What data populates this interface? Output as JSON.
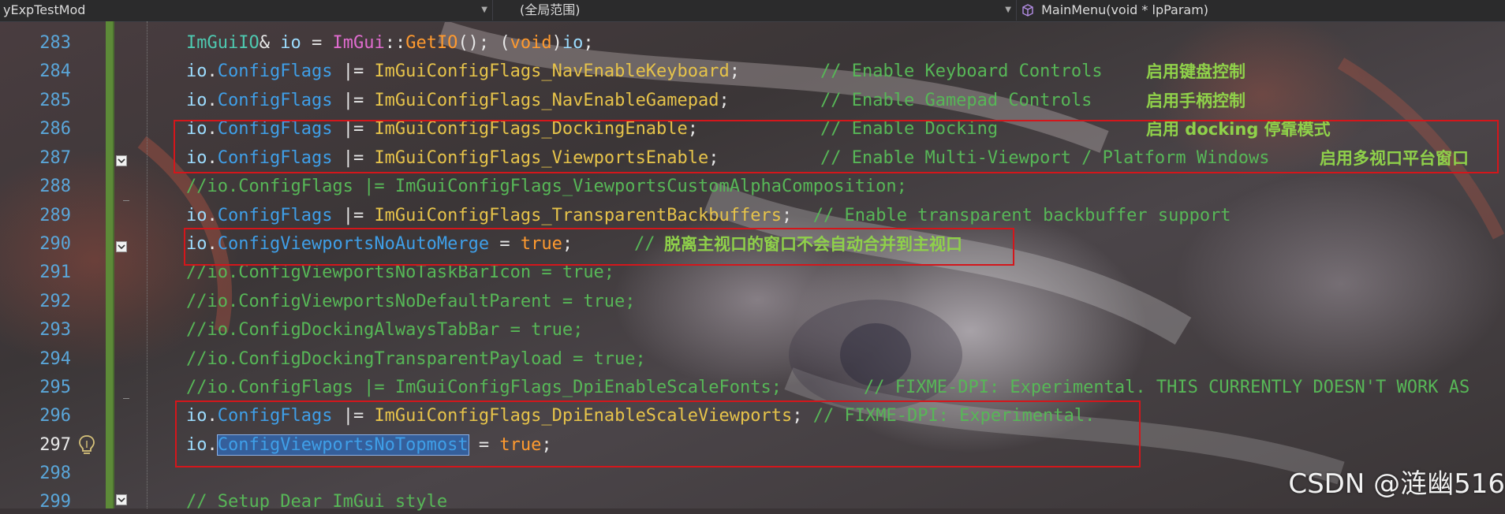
{
  "navbar": {
    "project": "yExpTestMod",
    "scope": "(全局范围)",
    "member": "MainMenu(void * lpParam)",
    "member_icon": "cube-icon"
  },
  "gutter": {
    "line_numbers": [
      "283",
      "284",
      "285",
      "286",
      "287",
      "288",
      "289",
      "290",
      "291",
      "292",
      "293",
      "294",
      "295",
      "296",
      "297",
      "298",
      "299"
    ],
    "current_line": "297",
    "fold_icon": "collapse-icon",
    "bulb_icon": "lightbulb-icon"
  },
  "code": {
    "l283": {
      "t1": "ImGuiIO",
      "t2": "& ",
      "t3": "io",
      "t4": " = ",
      "t5": "ImGui",
      "t6": "::",
      "t7": "GetIO",
      "t8": "(); (",
      "t9": "void",
      "t10": ")",
      "t11": "io",
      "t12": ";"
    },
    "l284": {
      "obj": "io",
      "dot": ".",
      "prop": "ConfigFlags",
      "op": " |= ",
      "flag": "ImGuiConfigFlags_NavEnableKeyboard",
      "semi": ";",
      "comment": "// Enable Keyboard Controls",
      "note": "启用键盘控制"
    },
    "l285": {
      "obj": "io",
      "dot": ".",
      "prop": "ConfigFlags",
      "op": " |= ",
      "flag": "ImGuiConfigFlags_NavEnableGamepad",
      "semi": ";",
      "comment": "// Enable Gamepad Controls",
      "note": "启用手柄控制"
    },
    "l286": {
      "obj": "io",
      "dot": ".",
      "prop": "ConfigFlags",
      "op": " |= ",
      "flag": "ImGuiConfigFlags_DockingEnable",
      "semi": ";",
      "comment": "// Enable Docking",
      "note": "启用 docking 停靠模式"
    },
    "l287": {
      "obj": "io",
      "dot": ".",
      "prop": "ConfigFlags",
      "op": " |= ",
      "flag": "ImGuiConfigFlags_ViewportsEnable",
      "semi": ";",
      "comment": "// Enable Multi-Viewport / Platform Windows",
      "note": "启用多视口平台窗口"
    },
    "l288": {
      "comment": "//io.ConfigFlags |= ImGuiConfigFlags_ViewportsCustomAlphaComposition;"
    },
    "l289": {
      "obj": "io",
      "dot": ".",
      "prop": "ConfigFlags",
      "op": " |= ",
      "flag": "ImGuiConfigFlags_TransparentBackbuffers",
      "semi": ";",
      "comment": "// Enable transparent backbuffer support"
    },
    "l290": {
      "obj": "io",
      "dot": ".",
      "prop": "ConfigViewportsNoAutoMerge",
      "op": " = ",
      "val": "true",
      "semi": ";",
      "comment": "//",
      "note": "脱离主视口的窗口不会自动合并到主视口"
    },
    "l291": {
      "comment": "//io.ConfigViewportsNoTaskBarIcon = true;"
    },
    "l292": {
      "comment": "//io.ConfigViewportsNoDefaultParent = true;"
    },
    "l293": {
      "comment": "//io.ConfigDockingAlwaysTabBar = true;"
    },
    "l294": {
      "comment": "//io.ConfigDockingTransparentPayload = true;"
    },
    "l295": {
      "code": "//io.ConfigFlags |= ImGuiConfigFlags_DpiEnableScaleFonts;",
      "comment": "// FIXME-DPI: Experimental. THIS CURRENTLY DOESN'T WORK AS"
    },
    "l296": {
      "obj": "io",
      "dot": ".",
      "prop": "ConfigFlags",
      "op": " |= ",
      "flag": "ImGuiConfigFlags_DpiEnableScaleViewports",
      "semi": ";",
      "comment": " // FIXME-DPI: Experimental."
    },
    "l297": {
      "obj": "io",
      "dot": ".",
      "prop": "ConfigViewportsNoTopmost",
      "op": " = ",
      "val": "true",
      "semi": ";"
    },
    "l299": {
      "comment": "// Setup Dear ImGui style"
    }
  },
  "watermark": "CSDN @涟幽516",
  "colors": {
    "highlight_box": "#d4161b",
    "change_bar": "#5d8a38",
    "selection": "#355f9b"
  }
}
